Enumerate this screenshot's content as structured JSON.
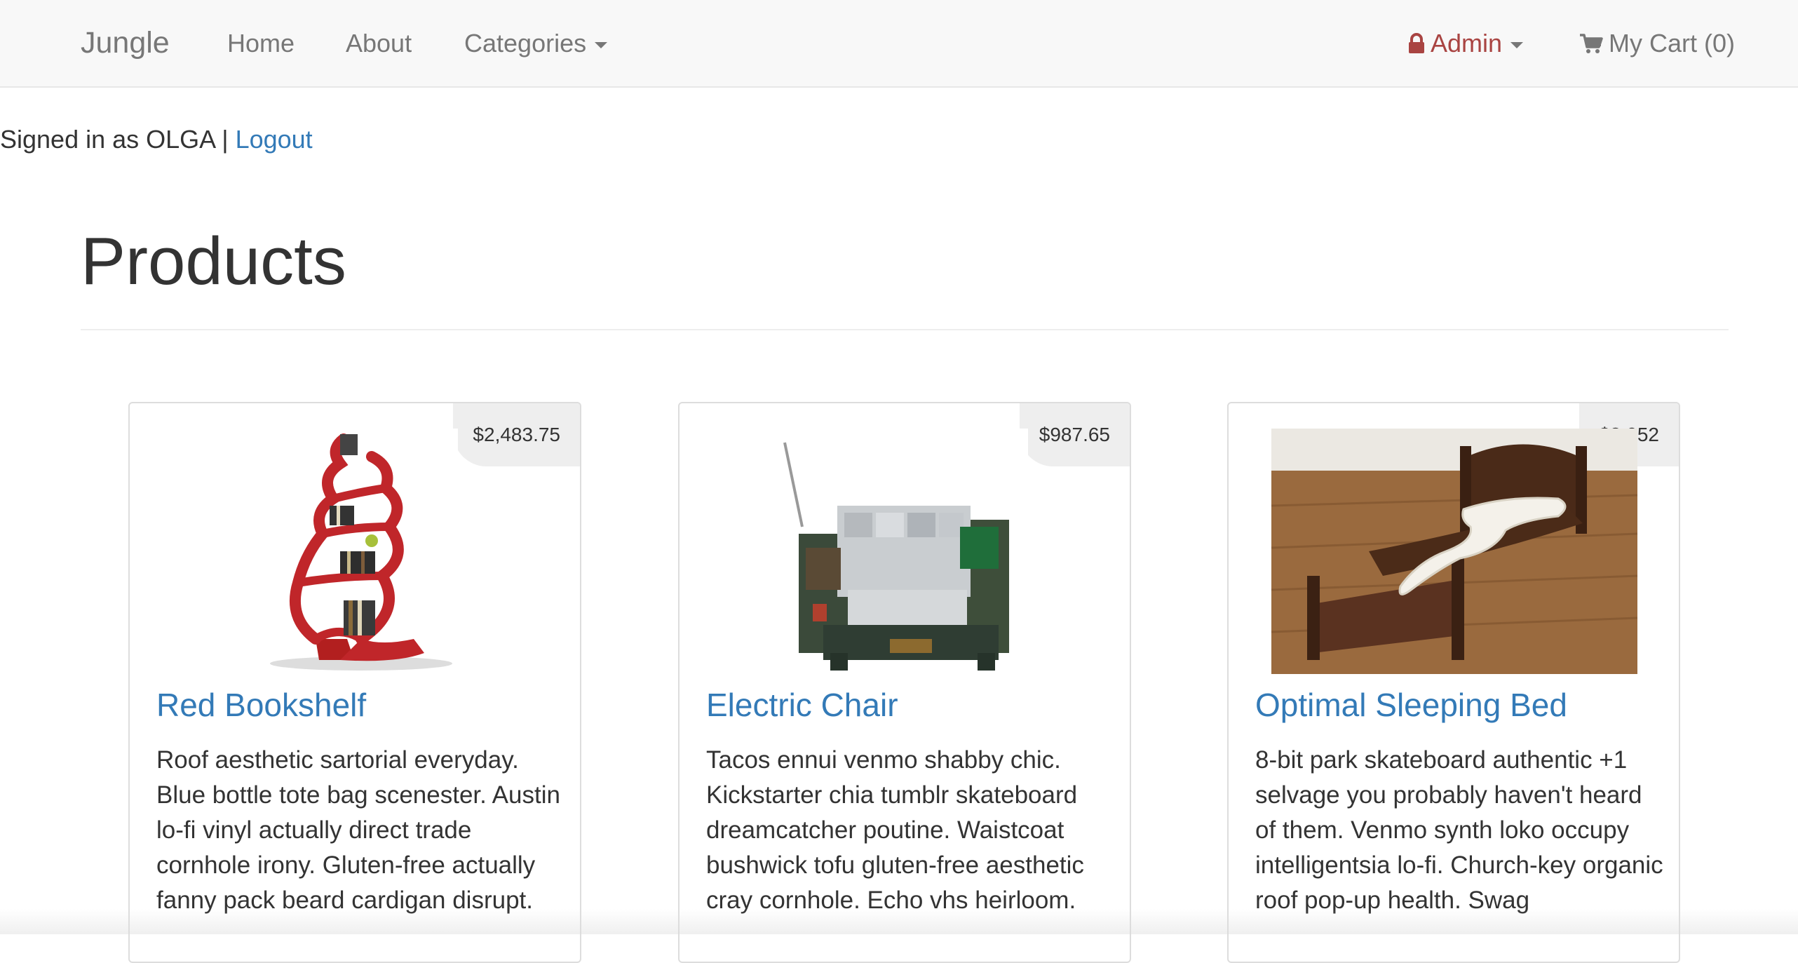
{
  "navbar": {
    "brand": "Jungle",
    "links": [
      "Home",
      "About",
      "Categories"
    ],
    "admin_label": "Admin",
    "cart_label": "My Cart (0)"
  },
  "session": {
    "signed_in_text": "Signed in as OLGA | ",
    "logout_label": "Logout"
  },
  "page": {
    "title": "Products"
  },
  "products": [
    {
      "name": "Red Bookshelf",
      "price": "$2,483.75",
      "description": "Roof aesthetic sartorial everyday. Blue bottle tote bag scenester. Austin lo-fi vinyl actually direct trade cornhole irony. Gluten-free actually fanny pack beard cardigan disrupt."
    },
    {
      "name": "Electric Chair",
      "price": "$987.65",
      "description": "Tacos ennui venmo shabby chic. Kickstarter chia tumblr skateboard dreamcatcher poutine. Waistcoat bushwick tofu gluten-free aesthetic cray cornhole. Echo vhs heirloom."
    },
    {
      "name": "Optimal Sleeping Bed",
      "price": "$3,052",
      "description": "8-bit park skateboard authentic +1 selvage you probably haven't heard of them. Venmo synth loko occupy intelligentsia lo-fi. Church-key organic roof pop-up health. Swag"
    }
  ],
  "colors": {
    "link": "#337ab7",
    "admin": "#a94442",
    "navbar_bg": "#f8f8f8",
    "price_badge_bg": "#eeeeee"
  },
  "icons": [
    "lock-icon",
    "cart-icon",
    "caret-down-icon"
  ]
}
